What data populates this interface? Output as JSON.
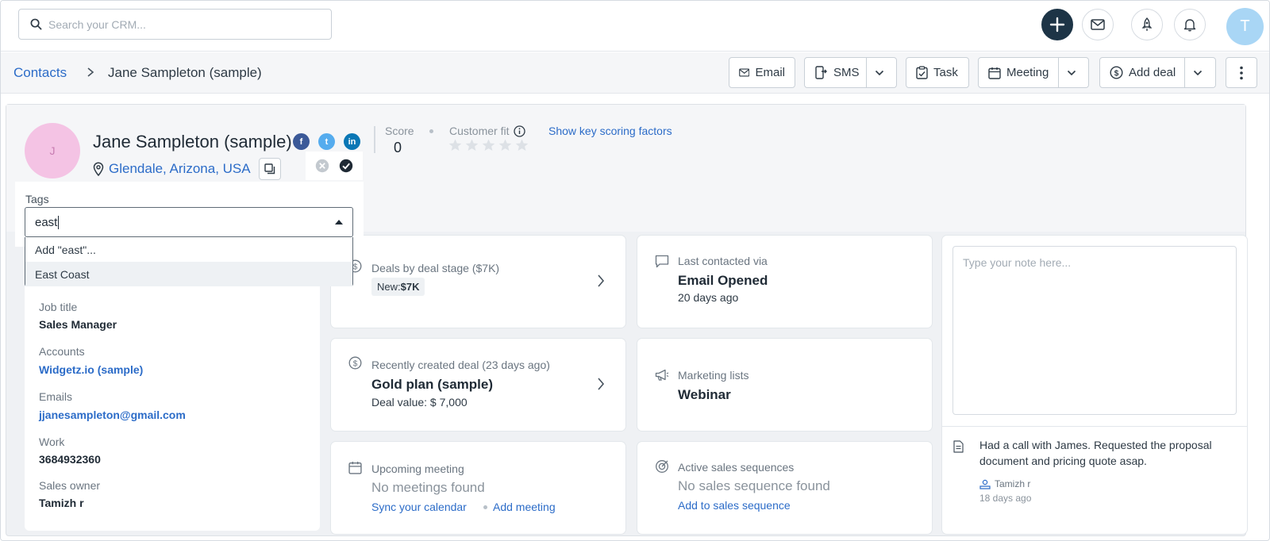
{
  "topbar": {
    "search_placeholder": "Search your CRM...",
    "avatar_initial": "T"
  },
  "breadcrumb": {
    "parent": "Contacts",
    "current": "Jane Sampleton (sample)"
  },
  "actions": {
    "email": "Email",
    "sms": "SMS",
    "task": "Task",
    "meeting": "Meeting",
    "add_deal": "Add deal"
  },
  "contact": {
    "avatar_initial": "J",
    "name": "Jane Sampleton (sample)",
    "location": "Glendale, Arizona, USA",
    "social": [
      "f",
      "t",
      "in"
    ],
    "score_label": "Score",
    "score": "0",
    "customer_fit_label": "Customer fit",
    "customer_fit_stars": 0,
    "show_key_link": "Show key scoring factors"
  },
  "tags": {
    "label": "Tags",
    "input_value": "east",
    "options": [
      "Add \"east\"...",
      "East Coast"
    ],
    "highlighted_index": 1
  },
  "details": {
    "job_title_label": "Job title",
    "job_title": "Sales Manager",
    "accounts_label": "Accounts",
    "account": "Widgetz.io (sample)",
    "emails_label": "Emails",
    "email": "jjanesampleton@gmail.com",
    "work_label": "Work",
    "work": "3684932360",
    "owner_label": "Sales owner",
    "owner": "Tamizh r"
  },
  "cards": {
    "deals_stage": {
      "label": "Deals by deal stage ($7K)",
      "pill_prefix": "New: ",
      "pill_value": "$7K"
    },
    "last_contacted": {
      "label": "Last contacted via",
      "value": "Email Opened",
      "sub": "20 days ago"
    },
    "recent_deal": {
      "label": "Recently created deal (23 days ago)",
      "value": "Gold plan (sample)",
      "sub": "Deal value: $ 7,000"
    },
    "marketing": {
      "label": "Marketing lists",
      "value": "Webinar"
    },
    "meeting": {
      "label": "Upcoming meeting",
      "empty": "No meetings found",
      "link1": "Sync your calendar",
      "link2": "Add meeting"
    },
    "sequences": {
      "label": "Active sales sequences",
      "empty": "No sales sequence found",
      "link": "Add to sales sequence"
    }
  },
  "notes": {
    "placeholder": "Type your note here...",
    "text": "Had a call with James. Requested the proposal document and pricing quote asap.",
    "author": "Tamizh r",
    "time": "18 days ago"
  },
  "colors": {
    "accent": "#2c6cc8",
    "plus_button": "#1d3446",
    "contact_avatar": "#f4c3e4",
    "user_avatar": "#a9d6f5",
    "facebook": "#3b5998",
    "twitter": "#55acee",
    "linkedin": "#0a77b5"
  }
}
